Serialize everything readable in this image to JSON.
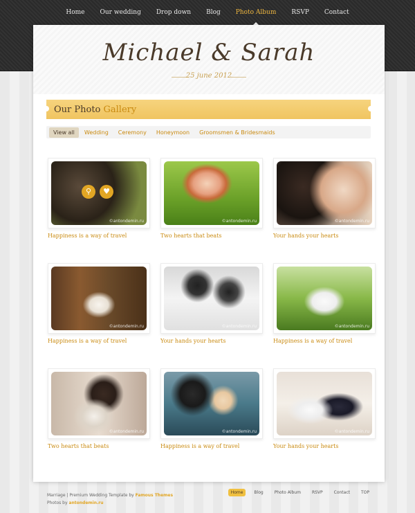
{
  "nav": [
    "Home",
    "Our wedding",
    "Drop down",
    "Blog",
    "Photo Album",
    "RSVP",
    "Contact"
  ],
  "nav_active_index": 4,
  "header": {
    "title": "Michael & Sarah",
    "date": "25 june 2012"
  },
  "gallery": {
    "title_part1": "Our Photo",
    "title_part2": "Gallery",
    "filters": [
      "View all",
      "Wedding",
      "Ceremony",
      "Honeymoon",
      "Groomsmen & Bridesmaids"
    ],
    "filter_active_index": 0,
    "watermark": "©antondemin.ru",
    "items": [
      {
        "caption": "Happiness is a way of travel"
      },
      {
        "caption": "Two hearts that beats"
      },
      {
        "caption": "Your hands your hearts"
      },
      {
        "caption": "Happiness is a way of travel"
      },
      {
        "caption": "Your hands your hearts"
      },
      {
        "caption": "Happiness is a way of travel"
      },
      {
        "caption": "Two hearts that beats"
      },
      {
        "caption": "Happiness is a way of travel"
      },
      {
        "caption": "Your hands your hearts"
      }
    ]
  },
  "footer": {
    "line1_text": "Marriage | Premium Wedding Template by",
    "line1_link": "Famous Themes",
    "line2_text": "Photos by",
    "line2_link": "antondemin.ru",
    "nav": [
      "Home",
      "Blog",
      "Photo Album",
      "RSVP",
      "Contact",
      "TOP"
    ],
    "nav_active_index": 0
  },
  "colors": {
    "accent": "#e2a624",
    "ribbon": "#f0c460",
    "topband": "#2e2e2e"
  },
  "icons": {
    "zoom": "magnifier-icon",
    "like": "heart-icon"
  }
}
